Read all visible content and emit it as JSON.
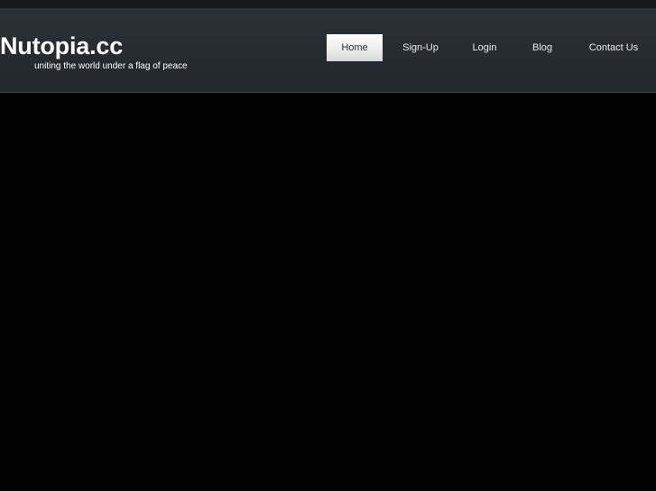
{
  "site": {
    "title": "Nutopia.cc",
    "tagline": "uniting the world under a flag of peace"
  },
  "nav": {
    "items": [
      {
        "label": "Home",
        "active": true
      },
      {
        "label": "Sign-Up",
        "active": false
      },
      {
        "label": "Login",
        "active": false
      },
      {
        "label": "Blog",
        "active": false
      },
      {
        "label": "Contact Us",
        "active": false
      }
    ]
  },
  "colors": {
    "background": "#000000",
    "header": "#262b30",
    "active_tab": "#ececed"
  }
}
